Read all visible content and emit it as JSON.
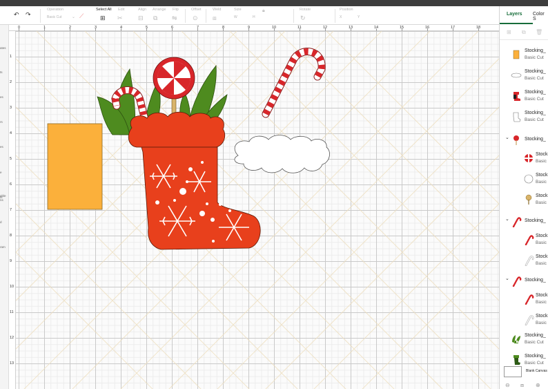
{
  "toolbar": {
    "undo_icon": "undo-icon",
    "redo_icon": "redo-icon",
    "operation_label": "Operation",
    "operation_value": "Basic Cut",
    "select_all_label": "Select All",
    "edit_label": "Edit",
    "align_label": "Align",
    "arrange_label": "Arrange",
    "flip_label": "Flip",
    "offset_label": "Offset",
    "weld_label": "Weld",
    "size_label": "Size",
    "size_w": "W",
    "size_h": "H",
    "rotate_label": "Rotate",
    "position_label": "Position",
    "position_x": "X",
    "position_y": "Y"
  },
  "rail": {
    "items": [
      "ates",
      "ts",
      "es",
      "rs",
      "es",
      "e",
      "ts",
      "able\nns",
      "d",
      "ram"
    ]
  },
  "ruler": {
    "top": [
      "0",
      "1",
      "2",
      "3",
      "4",
      "5",
      "6",
      "7",
      "8",
      "9",
      "10",
      "11",
      "12",
      "13",
      "14",
      "15",
      "16",
      "17",
      "18"
    ],
    "left": [
      "1",
      "2",
      "3",
      "4",
      "5",
      "6",
      "7",
      "8",
      "9",
      "10",
      "11",
      "12",
      "13"
    ]
  },
  "panel": {
    "tab_layers": "Layers",
    "tab_color_sync": "Color S",
    "layers": [
      {
        "name": "Stocking_",
        "op": "Basic Cut",
        "thumb": "orange-rectangle",
        "child": false
      },
      {
        "name": "Stocking_",
        "op": "Basic Cut",
        "thumb": "white-oval",
        "child": false
      },
      {
        "name": "Stocking_",
        "op": "Basic Cut",
        "thumb": "red-stocking",
        "child": false
      },
      {
        "name": "Stocking_",
        "op": "Basic Cut",
        "thumb": "white-stocking",
        "child": false
      },
      {
        "name": "Stocking_",
        "op": "",
        "thumb": "lollipop-group",
        "group": true
      },
      {
        "name": "Stock",
        "op": "Basic",
        "thumb": "red-peppermint",
        "child": true
      },
      {
        "name": "Stock",
        "op": "Basic",
        "thumb": "white-circle",
        "child": true
      },
      {
        "name": "Stock",
        "op": "Basic",
        "thumb": "tan-lollipop-stick",
        "child": true
      },
      {
        "name": "Stocking_",
        "op": "",
        "thumb": "candy-cane-group",
        "group": true
      },
      {
        "name": "Stock",
        "op": "Basic",
        "thumb": "red-candy-cane",
        "child": true
      },
      {
        "name": "Stock",
        "op": "Basic",
        "thumb": "white-candy-cane",
        "child": true
      },
      {
        "name": "Stocking_",
        "op": "",
        "thumb": "candy-cane-group",
        "group": true
      },
      {
        "name": "Stock",
        "op": "Basic",
        "thumb": "red-candy-cane",
        "child": true
      },
      {
        "name": "Stock",
        "op": "Basic",
        "thumb": "white-candy-cane",
        "child": true
      },
      {
        "name": "Stocking_",
        "op": "Basic Cut",
        "thumb": "green-leaves",
        "child": false
      },
      {
        "name": "Stocking_",
        "op": "Basic Cut",
        "thumb": "green-stocking",
        "child": false
      }
    ],
    "blank_canvas": "Blank Canvas"
  },
  "colors": {
    "accent": "#176d3a",
    "stocking_red": "#e8401c",
    "leaf_green": "#4e8b1f",
    "rect_orange": "#fbb03b",
    "cane_red": "#d8262a"
  }
}
